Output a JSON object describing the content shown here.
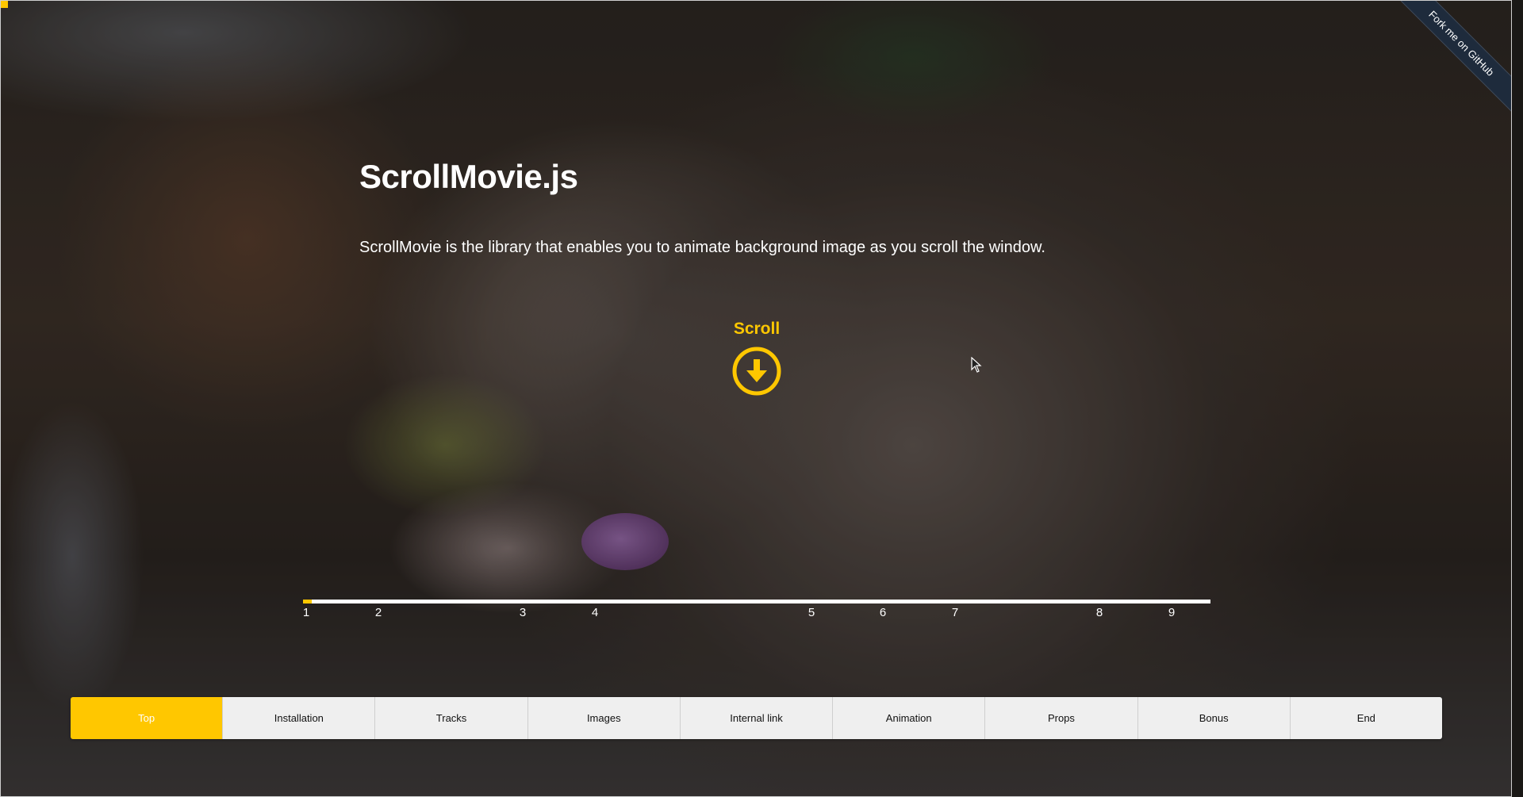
{
  "title": "ScrollMovie.js",
  "description": "ScrollMovie is the library that enables you to animate background image as you scroll the window.",
  "ribbon": {
    "label": "Fork me on GitHub"
  },
  "scroll_hint": {
    "label": "Scroll",
    "icon": "arrow-down-circle-icon"
  },
  "colors": {
    "accent": "#ffc700",
    "nav_bg": "#efefef",
    "ribbon_bg": "#1e2b3c"
  },
  "timeline": {
    "progress": 0.01,
    "markers": [
      "1",
      "2",
      "3",
      "4",
      "5",
      "6",
      "7",
      "8",
      "9"
    ]
  },
  "nav": {
    "active": "Top",
    "items": [
      "Top",
      "Installation",
      "Tracks",
      "Images",
      "Internal link",
      "Animation",
      "Props",
      "Bonus",
      "End"
    ]
  }
}
